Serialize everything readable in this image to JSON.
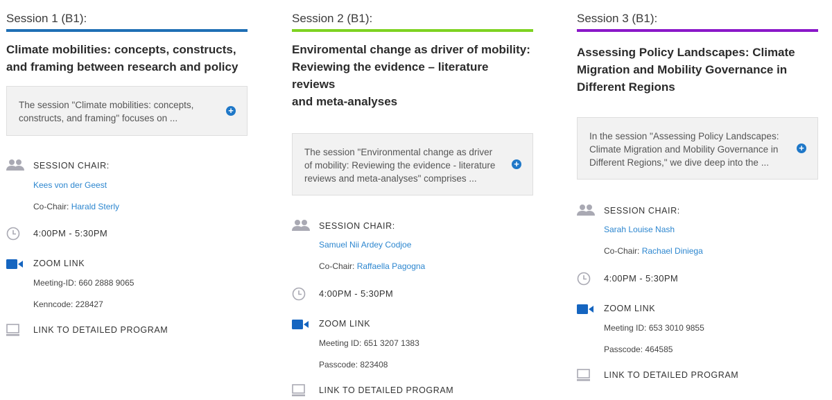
{
  "sessions": [
    {
      "heading": "Session 1 (B1):",
      "bar_color": "#1f6fb5",
      "title_lines": [
        "Climate mobilities: concepts, constructs,",
        "and framing between research and policy"
      ],
      "desc_lines": [
        "The session \"Climate mobilities: concepts,",
        "constructs, and framing\" focuses on ..."
      ],
      "chair_label": "SESSION CHAIR:",
      "chair_name": "Kees von der Geest",
      "cochair_prefix": "Co-Chair: ",
      "cochair_name": "Harald Sterly",
      "time": "4:00PM - 5:30PM",
      "zoom_label": "ZOOM LINK",
      "meeting": "Meeting-ID: 660 2888 9065",
      "passcode": "Kenncode: 228427",
      "program_label": "LINK TO DETAILED PROGRAM"
    },
    {
      "heading": "Session 2 (B1):",
      "bar_color": "#7ed321",
      "title_lines": [
        "Enviromental change as driver of mobility:",
        "Reviewing the evidence – literature reviews",
        "and meta-analyses"
      ],
      "desc_lines": [
        "The session \"Environmental change as driver",
        "of mobility: Reviewing the evidence - literature",
        "reviews and meta-analyses\" comprises ..."
      ],
      "chair_label": "SESSION CHAIR:",
      "chair_name": "Samuel Nii Ardey Codjoe",
      "cochair_prefix": "Co-Chair: ",
      "cochair_name": "Raffaella Pagogna",
      "time": "4:00PM - 5:30PM",
      "zoom_label": "ZOOM LINK",
      "meeting": "Meeting ID: 651 3207 1383",
      "passcode": "Passcode: 823408",
      "program_label": "LINK TO DETAILED PROGRAM"
    },
    {
      "heading": "Session 3 (B1):",
      "bar_color": "#8a17c9",
      "title_lines": [
        "Assessing Policy Landscapes: Climate",
        "Migration and Mobility Governance in",
        "Different Regions"
      ],
      "desc_lines": [
        "In the session \"Assessing Policy Landscapes:",
        "Climate Migration and Mobility Governance in",
        "Different Regions,\" we dive deep into the ..."
      ],
      "chair_label": "SESSION CHAIR:",
      "chair_name": "Sarah Louise Nash",
      "cochair_prefix": "Co-Chair: ",
      "cochair_name": "Rachael Diniega",
      "time": "4:00PM - 5:30PM",
      "zoom_label": "ZOOM LINK",
      "meeting": "Meeting ID: 653 3010 9855",
      "passcode": "Passcode: 464585",
      "program_label": "LINK TO DETAILED PROGRAM"
    }
  ],
  "icons": {
    "people": "people-icon",
    "clock": "clock-icon",
    "video": "video-camera-icon",
    "monitor": "monitor-icon",
    "expand": "plus-circle-icon"
  },
  "colors": {
    "icon_gray": "#a9a9b3",
    "icon_blue": "#1565c0",
    "link": "#2c86cf"
  }
}
